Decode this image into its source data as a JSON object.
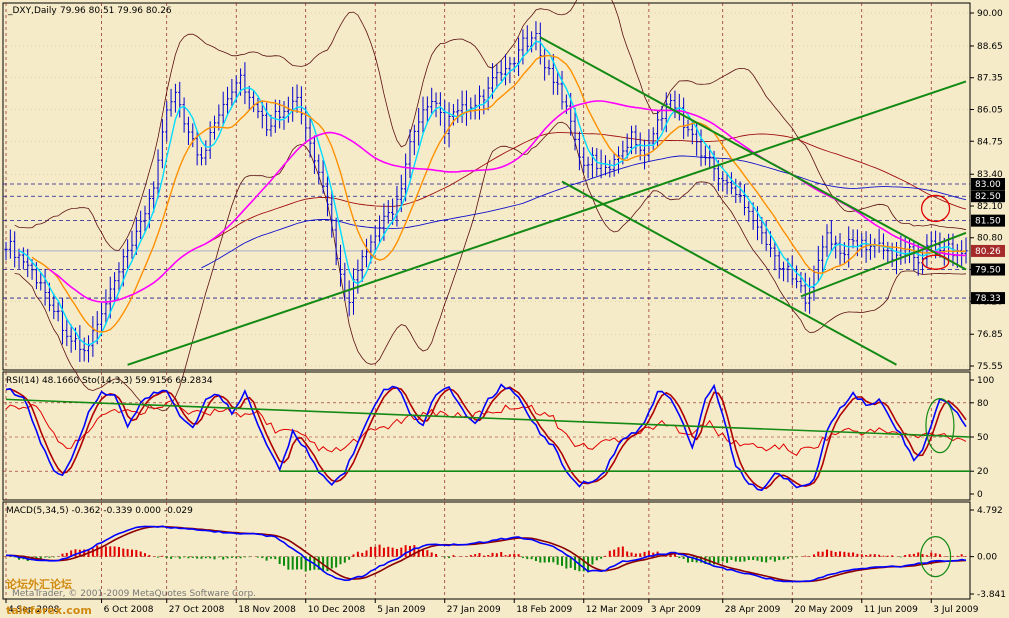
{
  "chart_data": [
    {
      "type": "line",
      "panel": "price",
      "title": "_DXY,Daily",
      "ohlc": "79.96 80.51 79.96 80.26",
      "ylim": [
        75.55,
        90.0
      ],
      "y_ticks": [
        "90.00",
        "88.65",
        "87.35",
        "86.05",
        "84.75",
        "83.40",
        "82.10",
        "80.80",
        "79.50",
        "78.20",
        "76.85",
        "75.55"
      ],
      "levels": [
        {
          "label": "83.00",
          "value": 83.0
        },
        {
          "label": "82.50",
          "value": 82.5
        },
        {
          "label": "81.50",
          "value": 81.5
        },
        {
          "label": "80.26",
          "value": 80.26
        },
        {
          "label": "79.50",
          "value": 79.5
        },
        {
          "label": "78.33",
          "value": 78.33
        }
      ],
      "x_labels": [
        "4 Sep 2008",
        "6 Oct 2008",
        "27 Oct 2008",
        "18 Nov 2008",
        "10 Dec 2008",
        "5 Jan 2009",
        "27 Jan 2009",
        "18 Feb 2009",
        "12 Mar 2009",
        "3 Apr 2009",
        "28 Apr 2009",
        "20 May 2009",
        "11 Jun 2009",
        "3 Jul 2009"
      ],
      "x_label_index": [
        0,
        22,
        37,
        53,
        69,
        85,
        101,
        117,
        133,
        148,
        165,
        181,
        197,
        213
      ],
      "n_bars": 222,
      "keypoints": [
        [
          0,
          80.6
        ],
        [
          5,
          79.7
        ],
        [
          10,
          78.3
        ],
        [
          15,
          76.6
        ],
        [
          18,
          76.1
        ],
        [
          22,
          77.6
        ],
        [
          26,
          79.4
        ],
        [
          30,
          80.8
        ],
        [
          34,
          83.0
        ],
        [
          37,
          85.8
        ],
        [
          39,
          86.9
        ],
        [
          42,
          85.1
        ],
        [
          45,
          83.9
        ],
        [
          48,
          85.7
        ],
        [
          51,
          86.7
        ],
        [
          54,
          87.4
        ],
        [
          57,
          86.1
        ],
        [
          60,
          85.4
        ],
        [
          64,
          86.2
        ],
        [
          67,
          86.4
        ],
        [
          70,
          84.6
        ],
        [
          74,
          82.0
        ],
        [
          77,
          79.2
        ],
        [
          79,
          78.4
        ],
        [
          81,
          79.5
        ],
        [
          84,
          80.4
        ],
        [
          87,
          81.6
        ],
        [
          90,
          82.2
        ],
        [
          93,
          84.6
        ],
        [
          96,
          85.8
        ],
        [
          99,
          86.3
        ],
        [
          101,
          85.3
        ],
        [
          104,
          86.0
        ],
        [
          108,
          86.1
        ],
        [
          112,
          87.1
        ],
        [
          116,
          87.9
        ],
        [
          119,
          88.7
        ],
        [
          122,
          88.9
        ],
        [
          125,
          87.6
        ],
        [
          128,
          86.6
        ],
        [
          131,
          85.0
        ],
        [
          133,
          83.5
        ],
        [
          135,
          84.0
        ],
        [
          138,
          83.5
        ],
        [
          141,
          84.3
        ],
        [
          144,
          84.9
        ],
        [
          147,
          84.4
        ],
        [
          150,
          85.4
        ],
        [
          152,
          86.5
        ],
        [
          155,
          85.9
        ],
        [
          158,
          84.9
        ],
        [
          161,
          84.1
        ],
        [
          164,
          83.4
        ],
        [
          167,
          82.7
        ],
        [
          170,
          82.3
        ],
        [
          173,
          81.4
        ],
        [
          176,
          80.2
        ],
        [
          179,
          79.6
        ],
        [
          182,
          78.9
        ],
        [
          184,
          78.4
        ],
        [
          186,
          79.6
        ],
        [
          189,
          80.8
        ],
        [
          192,
          80.2
        ],
        [
          195,
          80.6
        ],
        [
          198,
          80.5
        ],
        [
          201,
          80.4
        ],
        [
          204,
          80.1
        ],
        [
          207,
          80.3
        ],
        [
          210,
          79.9
        ],
        [
          213,
          80.5
        ],
        [
          216,
          80.4
        ],
        [
          219,
          80.2
        ],
        [
          221,
          80.26
        ]
      ]
    },
    {
      "type": "line",
      "panel": "rsi-stochastic",
      "title": "RSI(14) 48.1660 Sto(14,3,3) 59.9156 69.2834",
      "ylim": [
        0,
        100
      ],
      "y_ticks": [
        "100",
        "80",
        "50",
        "20",
        "0"
      ],
      "stoch_keypoints": [
        [
          0,
          93
        ],
        [
          4,
          85
        ],
        [
          8,
          45
        ],
        [
          11,
          20
        ],
        [
          13,
          15
        ],
        [
          16,
          38
        ],
        [
          19,
          70
        ],
        [
          22,
          90
        ],
        [
          25,
          85
        ],
        [
          28,
          60
        ],
        [
          31,
          80
        ],
        [
          34,
          88
        ],
        [
          37,
          92
        ],
        [
          40,
          70
        ],
        [
          43,
          58
        ],
        [
          46,
          82
        ],
        [
          49,
          88
        ],
        [
          52,
          72
        ],
        [
          55,
          90
        ],
        [
          58,
          60
        ],
        [
          61,
          35
        ],
        [
          63,
          20
        ],
        [
          66,
          55
        ],
        [
          69,
          40
        ],
        [
          72,
          18
        ],
        [
          75,
          8
        ],
        [
          78,
          20
        ],
        [
          81,
          45
        ],
        [
          84,
          70
        ],
        [
          87,
          90
        ],
        [
          90,
          95
        ],
        [
          93,
          70
        ],
        [
          96,
          60
        ],
        [
          99,
          88
        ],
        [
          102,
          92
        ],
        [
          105,
          75
        ],
        [
          108,
          60
        ],
        [
          111,
          82
        ],
        [
          114,
          95
        ],
        [
          117,
          90
        ],
        [
          120,
          72
        ],
        [
          123,
          52
        ],
        [
          126,
          42
        ],
        [
          129,
          20
        ],
        [
          132,
          8
        ],
        [
          135,
          12
        ],
        [
          138,
          20
        ],
        [
          141,
          45
        ],
        [
          144,
          52
        ],
        [
          147,
          62
        ],
        [
          150,
          90
        ],
        [
          153,
          85
        ],
        [
          156,
          60
        ],
        [
          158,
          40
        ],
        [
          161,
          85
        ],
        [
          163,
          95
        ],
        [
          166,
          55
        ],
        [
          168,
          25
        ],
        [
          171,
          8
        ],
        [
          174,
          5
        ],
        [
          177,
          18
        ],
        [
          180,
          12
        ],
        [
          183,
          5
        ],
        [
          186,
          12
        ],
        [
          189,
          55
        ],
        [
          192,
          75
        ],
        [
          195,
          88
        ],
        [
          198,
          78
        ],
        [
          201,
          82
        ],
        [
          203,
          70
        ],
        [
          206,
          52
        ],
        [
          209,
          30
        ],
        [
          211,
          38
        ],
        [
          213,
          60
        ],
        [
          215,
          85
        ],
        [
          218,
          75
        ],
        [
          221,
          60
        ]
      ],
      "rsi_keypoints": [
        [
          0,
          74
        ],
        [
          6,
          78
        ],
        [
          10,
          60
        ],
        [
          14,
          38
        ],
        [
          18,
          52
        ],
        [
          22,
          72
        ],
        [
          26,
          74
        ],
        [
          30,
          70
        ],
        [
          34,
          78
        ],
        [
          38,
          80
        ],
        [
          42,
          70
        ],
        [
          46,
          70
        ],
        [
          50,
          76
        ],
        [
          54,
          66
        ],
        [
          58,
          72
        ],
        [
          62,
          56
        ],
        [
          66,
          54
        ],
        [
          70,
          46
        ],
        [
          74,
          36
        ],
        [
          78,
          40
        ],
        [
          82,
          50
        ],
        [
          86,
          58
        ],
        [
          90,
          62
        ],
        [
          94,
          68
        ],
        [
          98,
          72
        ],
        [
          102,
          70
        ],
        [
          106,
          66
        ],
        [
          110,
          72
        ],
        [
          114,
          74
        ],
        [
          118,
          78
        ],
        [
          122,
          74
        ],
        [
          126,
          66
        ],
        [
          130,
          46
        ],
        [
          134,
          40
        ],
        [
          138,
          46
        ],
        [
          142,
          50
        ],
        [
          146,
          54
        ],
        [
          150,
          62
        ],
        [
          154,
          58
        ],
        [
          158,
          54
        ],
        [
          162,
          62
        ],
        [
          166,
          46
        ],
        [
          170,
          44
        ],
        [
          174,
          40
        ],
        [
          178,
          42
        ],
        [
          182,
          36
        ],
        [
          186,
          42
        ],
        [
          190,
          52
        ],
        [
          194,
          56
        ],
        [
          198,
          54
        ],
        [
          202,
          56
        ],
        [
          206,
          52
        ],
        [
          210,
          50
        ],
        [
          214,
          54
        ],
        [
          218,
          50
        ],
        [
          221,
          48
        ]
      ],
      "annotation": "green ellipse around latest Stochastic/RSI values"
    },
    {
      "type": "bar",
      "panel": "macd",
      "title": "MACD(5,34,5) -0.362 -0.339 0.000 -0.029",
      "ylim": [
        -3.841,
        4.792
      ],
      "y_ticks": [
        "4.792",
        "0.00",
        "-3.841"
      ],
      "macd_keypoints": [
        [
          0,
          0.2
        ],
        [
          6,
          -0.3
        ],
        [
          12,
          -0.4
        ],
        [
          18,
          0.5
        ],
        [
          24,
          2.0
        ],
        [
          30,
          3.0
        ],
        [
          36,
          3.1
        ],
        [
          42,
          2.8
        ],
        [
          48,
          2.6
        ],
        [
          54,
          2.3
        ],
        [
          58,
          2.3
        ],
        [
          62,
          2.0
        ],
        [
          66,
          0.8
        ],
        [
          70,
          -0.5
        ],
        [
          74,
          -1.8
        ],
        [
          78,
          -2.5
        ],
        [
          82,
          -2.0
        ],
        [
          86,
          -1.0
        ],
        [
          90,
          -0.2
        ],
        [
          94,
          0.8
        ],
        [
          98,
          1.3
        ],
        [
          102,
          1.2
        ],
        [
          106,
          1.3
        ],
        [
          110,
          1.5
        ],
        [
          114,
          1.8
        ],
        [
          118,
          2.0
        ],
        [
          122,
          1.6
        ],
        [
          126,
          1.0
        ],
        [
          130,
          0.0
        ],
        [
          134,
          -1.5
        ],
        [
          138,
          -1.4
        ],
        [
          142,
          -0.5
        ],
        [
          146,
          -0.2
        ],
        [
          150,
          0.2
        ],
        [
          154,
          0.4
        ],
        [
          158,
          -0.1
        ],
        [
          162,
          -0.8
        ],
        [
          166,
          -1.3
        ],
        [
          170,
          -1.7
        ],
        [
          174,
          -2.1
        ],
        [
          178,
          -2.5
        ],
        [
          182,
          -2.6
        ],
        [
          186,
          -2.4
        ],
        [
          190,
          -1.8
        ],
        [
          194,
          -1.4
        ],
        [
          198,
          -1.2
        ],
        [
          202,
          -1.0
        ],
        [
          206,
          -1.0
        ],
        [
          210,
          -0.7
        ],
        [
          214,
          -0.5
        ],
        [
          218,
          -0.4
        ],
        [
          221,
          -0.36
        ]
      ],
      "annotation": "green ellipse around latest MACD values"
    }
  ],
  "colors": {
    "background": "#f6ebc9",
    "price_bars": "#0000cc",
    "ma_fast": "#00dcff",
    "ma_mid": "#ff9000",
    "ma_slow": "#ff00ff",
    "ma_long_red": "#a01010",
    "ma_long_blue": "#1010cc",
    "trendlines": "#138a13",
    "stoch": "#0000ff",
    "rsi": "#e00000",
    "macd_pos": "#e00000",
    "macd_neg": "#0a8a0a",
    "level_tag_bg": "#000000",
    "current_tag_bg": "#a52a2a"
  },
  "footer": {
    "copyright": "MetaTrader, © 2001-2009 MetaQuotes Software Corp.",
    "watermark_cn": "论坛外汇论坛",
    "watermark_site": "talkforex.com"
  }
}
